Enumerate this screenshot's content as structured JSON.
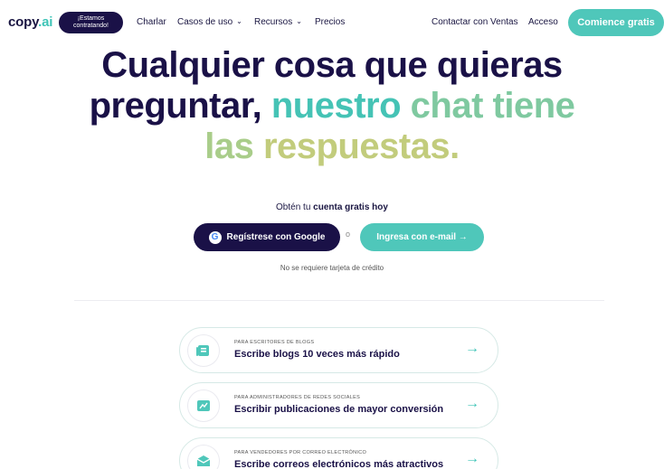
{
  "header": {
    "logo_text": "copy",
    "logo_suffix": ".ai",
    "hiring_badge_line1": "¡Estamos",
    "hiring_badge_line2": "contratando!",
    "nav_items": [
      {
        "label": "Charlar"
      },
      {
        "label": "Casos de uso",
        "has_dropdown": true
      },
      {
        "label": "Recursos",
        "has_dropdown": true
      },
      {
        "label": "Precios"
      }
    ],
    "contact_sales": "Contactar con Ventas",
    "login": "Acceso",
    "start_free": "Comience gratis"
  },
  "hero": {
    "line1": "Cualquier cosa que quieras",
    "line2_a": "preguntar,",
    "line2_b": "nuestro",
    "line2_c": "chat",
    "line2_d": "tiene",
    "line3_a": "las",
    "line3_b": "respuestas."
  },
  "signup": {
    "offer_prefix": "Obtén tu",
    "offer_bold": "cuenta gratis hoy",
    "google_button": "Regístrese con Google",
    "separator": "o",
    "email_button": "Ingresa con e-mail →",
    "no_card_note": "No se requiere tarjeta de crédito"
  },
  "use_cases": [
    {
      "eyebrow": "PARA ESCRITORES DE BLOGS",
      "title": "Escribe blogs 10 veces más rápido",
      "icon": "blog-icon"
    },
    {
      "eyebrow": "PARA ADMINISTRADORES DE REDES SOCIALES",
      "title": "Escribir publicaciones de mayor conversión",
      "icon": "social-post-icon"
    },
    {
      "eyebrow": "PARA VENDEDORES POR CORREO ELECTRÓNICO",
      "title": "Escribe correos electrónicos más atractivos",
      "icon": "email-icon"
    }
  ],
  "colors": {
    "navy": "#1a1147",
    "teal": "#4fc7ba",
    "green": "#a9cd8a"
  }
}
